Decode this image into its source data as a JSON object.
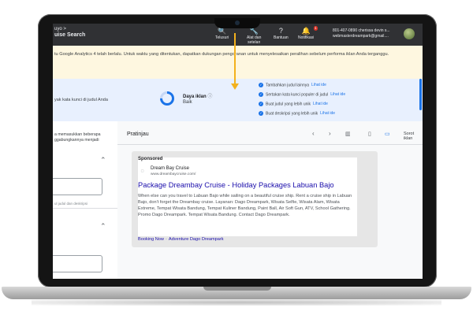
{
  "topbar": {
    "breadcrumb_top": "uyo >",
    "breadcrumb_campaign": "uise Search",
    "items": [
      {
        "icon": "search-icon",
        "glyph": "🔍",
        "label": "Telusuri"
      },
      {
        "icon": "tools-icon",
        "glyph": "🔧",
        "label_line1": "Alat dan",
        "label_line2": "setelan"
      },
      {
        "icon": "help-icon",
        "glyph": "?",
        "label": "Bantuan"
      },
      {
        "icon": "bell-icon",
        "glyph": "🔔",
        "label": "Notifikasi",
        "badge": "1"
      }
    ],
    "account_line1": "801-407-0890 cherissa devin s...",
    "account_line2": "webmasterdreampark@gmail...."
  },
  "banner": {
    "text": "tu Google Analytics 4 telah berlalu. Untuk waktu yang ditentukan, dapatkan dukungan pengoranan untuk menyelesaikan peralihan sebelum performa iklan Anda terganggu."
  },
  "strength": {
    "keyword_hint": "yak kata kunci di judul Anda",
    "label": "Daya iklan",
    "value": "Baik",
    "value_fraction": 0.75,
    "suggestions": [
      {
        "text": "Tambahkan judul lainnya",
        "link": "Lihat ide"
      },
      {
        "text": "Sertakan kata kunci populer di judul",
        "link": "Lihat ide"
      },
      {
        "text": "Buat judul yang lebih unik",
        "link": "Lihat ide"
      },
      {
        "text": "Buat deskripsi yang lebih unik",
        "link": "Lihat ide"
      }
    ]
  },
  "left_panel": {
    "line1": "a memasukkan beberapa",
    "line2": "ggabungkannya menjadi",
    "hint": "ul judul dan deskripsi"
  },
  "preview": {
    "title": "Pratinjau",
    "toggle_label": "Sorot iklan",
    "toggle_on": true
  },
  "ad": {
    "sponsored": "Sponsored",
    "advertiser": "Dream Bay Cruise",
    "display_url": "www.dreambaycruise.com/",
    "headline": "Package Dreambay Cruise - Holiday Packages Labuan Bajo",
    "description": "When else can you travel to Labuan Bajo while sailing on a beautiful cruise ship. Rent a cruise ship in Labuan Bajo, don't forget the Dreambay cruise. Layanan: Dago Dreampark, Wisata Selfie, Wisata Alam, Wisata Extreme, Tempat Wisata Bandung, Tempat Kuliner Bandung, Paint Ball, Air Soft Gun, ATV, School Gathering. Promo Dago Dreampark. Tempat Wisata Bandung. Contact Dago Dreampark.",
    "sitelink1": "Booking Now",
    "sitelink_sep": "·",
    "sitelink2": "Adventure Dago Dreampark"
  },
  "colors": {
    "accent": "#1a73e8",
    "arrow": "#f3b11d",
    "banner_bg": "#fef7e0",
    "strength_bg": "#e8f0fe",
    "headline_link": "#1a0dab"
  }
}
